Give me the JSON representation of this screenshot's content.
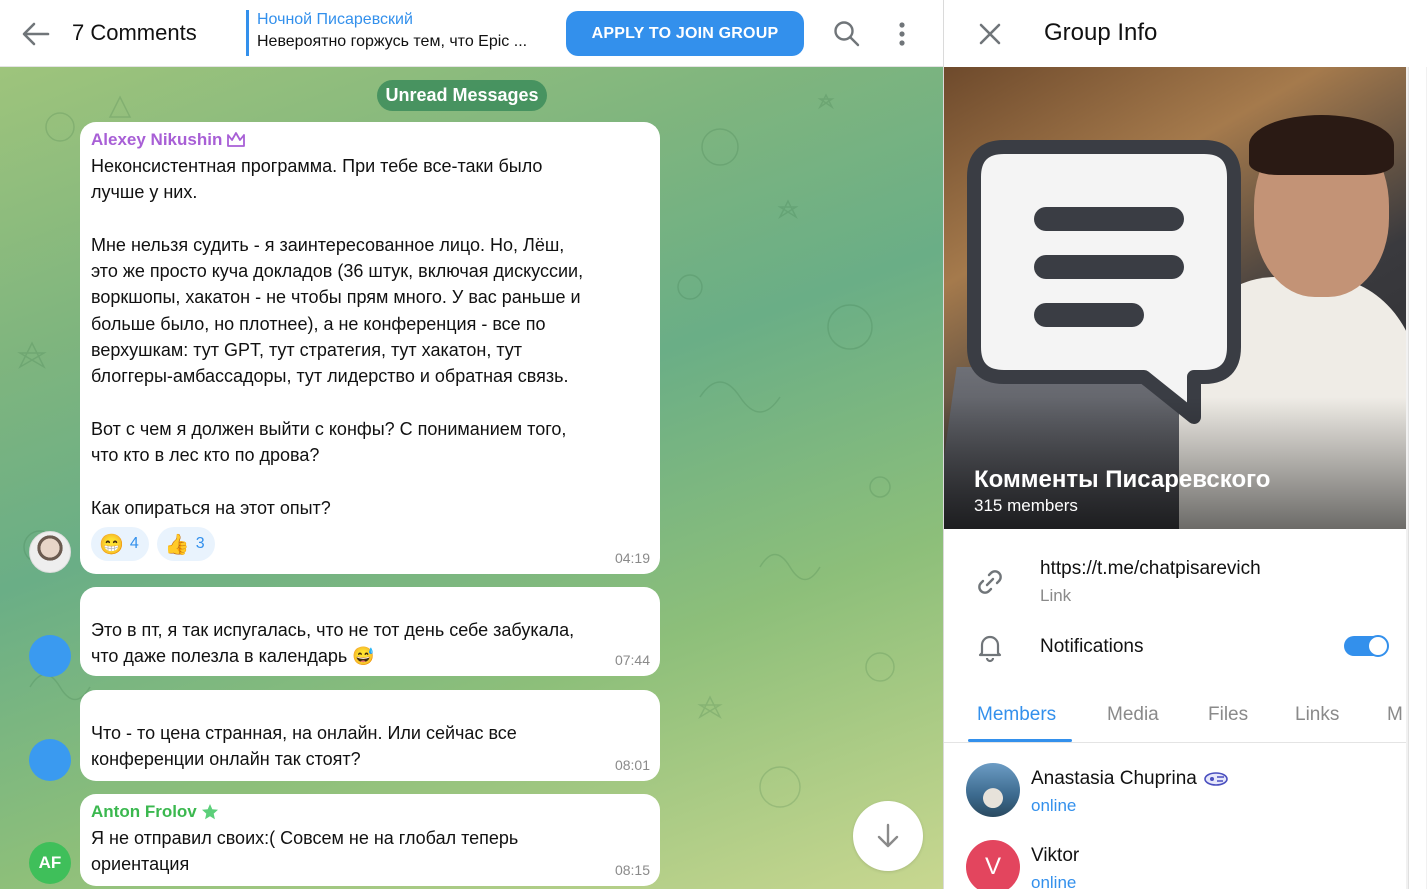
{
  "chat": {
    "header": {
      "title": "7 Comments",
      "pinned_author": "Ночной Писаревский",
      "pinned_text": "Невероятно горжусь тем, что Epic ...",
      "join_button": "APPLY TO JOIN GROUP"
    },
    "unread_label": "Unread Messages",
    "messages": [
      {
        "author": "Alexey Nikushin",
        "author_color": "#a85fd6",
        "text": "Неконсистентная программа. При тебе все-таки было\nлучше у них.\n\nМне нельзя судить - я заинтересованное лицо. Но, Лёш,\nэто же просто куча докладов (36 штук, включая дискуссии,\nворкшопы, хакатон - не чтобы прям много. У вас раньше и\nбольше было, но плотнее), а не конференция - все по\nверхушкам: тут GPT, тут стратегия, тут хакатон, тут\nблоггеры-амбассадоры, тут лидерство и обратная связь.\n\nВот с чем я должен выйти с конфы? С пониманием того,\nчто кто в лес кто по дрова?\n\nКак опираться на этот опыт?",
        "reactions": [
          {
            "emoji": "😁",
            "count": "4"
          },
          {
            "emoji": "👍",
            "count": "3"
          }
        ],
        "time": "04:19"
      },
      {
        "text": "Это в пт, я так испугалась, что не тот день себе забукала,\nчто даже полезла в календарь 😅",
        "time": "07:44"
      },
      {
        "text": "Что - то цена странная, на онлайн. Или сейчас все\nконференции онлайн так стоят?",
        "time": "08:01"
      },
      {
        "author": "Anton Frolov",
        "author_color": "#3bb84f",
        "avatar_initials": "AF",
        "text": "Я не отправил своих:( Совсем не на глобал теперь\nориентация",
        "time": "08:15"
      }
    ]
  },
  "info": {
    "title": "Group Info",
    "group_name": "Комменты Писаревского",
    "members_count": "315 members",
    "link": "https://t.me/chatpisarevich",
    "link_label": "Link",
    "notifications_label": "Notifications",
    "notifications_enabled": true,
    "tabs": [
      "Members",
      "Media",
      "Files",
      "Links",
      "M"
    ],
    "active_tab": "Members",
    "members": [
      {
        "name": "Anastasia Chuprina",
        "status": "online"
      },
      {
        "name": "Viktor",
        "initial": "V",
        "status": "online"
      }
    ]
  },
  "colors": {
    "accent": "#3390ec",
    "toggle_on": "#3390ec",
    "viktor_avatar": "#e3455e"
  }
}
